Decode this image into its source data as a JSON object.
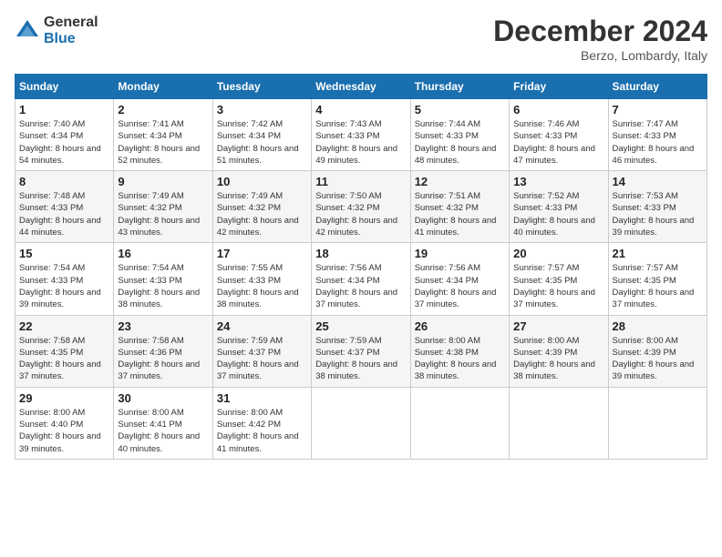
{
  "logo": {
    "general": "General",
    "blue": "Blue"
  },
  "title": "December 2024",
  "location": "Berzo, Lombardy, Italy",
  "days_of_week": [
    "Sunday",
    "Monday",
    "Tuesday",
    "Wednesday",
    "Thursday",
    "Friday",
    "Saturday"
  ],
  "weeks": [
    [
      {
        "day": "1",
        "sunrise": "Sunrise: 7:40 AM",
        "sunset": "Sunset: 4:34 PM",
        "daylight": "Daylight: 8 hours and 54 minutes."
      },
      {
        "day": "2",
        "sunrise": "Sunrise: 7:41 AM",
        "sunset": "Sunset: 4:34 PM",
        "daylight": "Daylight: 8 hours and 52 minutes."
      },
      {
        "day": "3",
        "sunrise": "Sunrise: 7:42 AM",
        "sunset": "Sunset: 4:34 PM",
        "daylight": "Daylight: 8 hours and 51 minutes."
      },
      {
        "day": "4",
        "sunrise": "Sunrise: 7:43 AM",
        "sunset": "Sunset: 4:33 PM",
        "daylight": "Daylight: 8 hours and 49 minutes."
      },
      {
        "day": "5",
        "sunrise": "Sunrise: 7:44 AM",
        "sunset": "Sunset: 4:33 PM",
        "daylight": "Daylight: 8 hours and 48 minutes."
      },
      {
        "day": "6",
        "sunrise": "Sunrise: 7:46 AM",
        "sunset": "Sunset: 4:33 PM",
        "daylight": "Daylight: 8 hours and 47 minutes."
      },
      {
        "day": "7",
        "sunrise": "Sunrise: 7:47 AM",
        "sunset": "Sunset: 4:33 PM",
        "daylight": "Daylight: 8 hours and 46 minutes."
      }
    ],
    [
      {
        "day": "8",
        "sunrise": "Sunrise: 7:48 AM",
        "sunset": "Sunset: 4:33 PM",
        "daylight": "Daylight: 8 hours and 44 minutes."
      },
      {
        "day": "9",
        "sunrise": "Sunrise: 7:49 AM",
        "sunset": "Sunset: 4:32 PM",
        "daylight": "Daylight: 8 hours and 43 minutes."
      },
      {
        "day": "10",
        "sunrise": "Sunrise: 7:49 AM",
        "sunset": "Sunset: 4:32 PM",
        "daylight": "Daylight: 8 hours and 42 minutes."
      },
      {
        "day": "11",
        "sunrise": "Sunrise: 7:50 AM",
        "sunset": "Sunset: 4:32 PM",
        "daylight": "Daylight: 8 hours and 42 minutes."
      },
      {
        "day": "12",
        "sunrise": "Sunrise: 7:51 AM",
        "sunset": "Sunset: 4:32 PM",
        "daylight": "Daylight: 8 hours and 41 minutes."
      },
      {
        "day": "13",
        "sunrise": "Sunrise: 7:52 AM",
        "sunset": "Sunset: 4:33 PM",
        "daylight": "Daylight: 8 hours and 40 minutes."
      },
      {
        "day": "14",
        "sunrise": "Sunrise: 7:53 AM",
        "sunset": "Sunset: 4:33 PM",
        "daylight": "Daylight: 8 hours and 39 minutes."
      }
    ],
    [
      {
        "day": "15",
        "sunrise": "Sunrise: 7:54 AM",
        "sunset": "Sunset: 4:33 PM",
        "daylight": "Daylight: 8 hours and 39 minutes."
      },
      {
        "day": "16",
        "sunrise": "Sunrise: 7:54 AM",
        "sunset": "Sunset: 4:33 PM",
        "daylight": "Daylight: 8 hours and 38 minutes."
      },
      {
        "day": "17",
        "sunrise": "Sunrise: 7:55 AM",
        "sunset": "Sunset: 4:33 PM",
        "daylight": "Daylight: 8 hours and 38 minutes."
      },
      {
        "day": "18",
        "sunrise": "Sunrise: 7:56 AM",
        "sunset": "Sunset: 4:34 PM",
        "daylight": "Daylight: 8 hours and 37 minutes."
      },
      {
        "day": "19",
        "sunrise": "Sunrise: 7:56 AM",
        "sunset": "Sunset: 4:34 PM",
        "daylight": "Daylight: 8 hours and 37 minutes."
      },
      {
        "day": "20",
        "sunrise": "Sunrise: 7:57 AM",
        "sunset": "Sunset: 4:35 PM",
        "daylight": "Daylight: 8 hours and 37 minutes."
      },
      {
        "day": "21",
        "sunrise": "Sunrise: 7:57 AM",
        "sunset": "Sunset: 4:35 PM",
        "daylight": "Daylight: 8 hours and 37 minutes."
      }
    ],
    [
      {
        "day": "22",
        "sunrise": "Sunrise: 7:58 AM",
        "sunset": "Sunset: 4:35 PM",
        "daylight": "Daylight: 8 hours and 37 minutes."
      },
      {
        "day": "23",
        "sunrise": "Sunrise: 7:58 AM",
        "sunset": "Sunset: 4:36 PM",
        "daylight": "Daylight: 8 hours and 37 minutes."
      },
      {
        "day": "24",
        "sunrise": "Sunrise: 7:59 AM",
        "sunset": "Sunset: 4:37 PM",
        "daylight": "Daylight: 8 hours and 37 minutes."
      },
      {
        "day": "25",
        "sunrise": "Sunrise: 7:59 AM",
        "sunset": "Sunset: 4:37 PM",
        "daylight": "Daylight: 8 hours and 38 minutes."
      },
      {
        "day": "26",
        "sunrise": "Sunrise: 8:00 AM",
        "sunset": "Sunset: 4:38 PM",
        "daylight": "Daylight: 8 hours and 38 minutes."
      },
      {
        "day": "27",
        "sunrise": "Sunrise: 8:00 AM",
        "sunset": "Sunset: 4:39 PM",
        "daylight": "Daylight: 8 hours and 38 minutes."
      },
      {
        "day": "28",
        "sunrise": "Sunrise: 8:00 AM",
        "sunset": "Sunset: 4:39 PM",
        "daylight": "Daylight: 8 hours and 39 minutes."
      }
    ],
    [
      {
        "day": "29",
        "sunrise": "Sunrise: 8:00 AM",
        "sunset": "Sunset: 4:40 PM",
        "daylight": "Daylight: 8 hours and 39 minutes."
      },
      {
        "day": "30",
        "sunrise": "Sunrise: 8:00 AM",
        "sunset": "Sunset: 4:41 PM",
        "daylight": "Daylight: 8 hours and 40 minutes."
      },
      {
        "day": "31",
        "sunrise": "Sunrise: 8:00 AM",
        "sunset": "Sunset: 4:42 PM",
        "daylight": "Daylight: 8 hours and 41 minutes."
      },
      null,
      null,
      null,
      null
    ]
  ]
}
